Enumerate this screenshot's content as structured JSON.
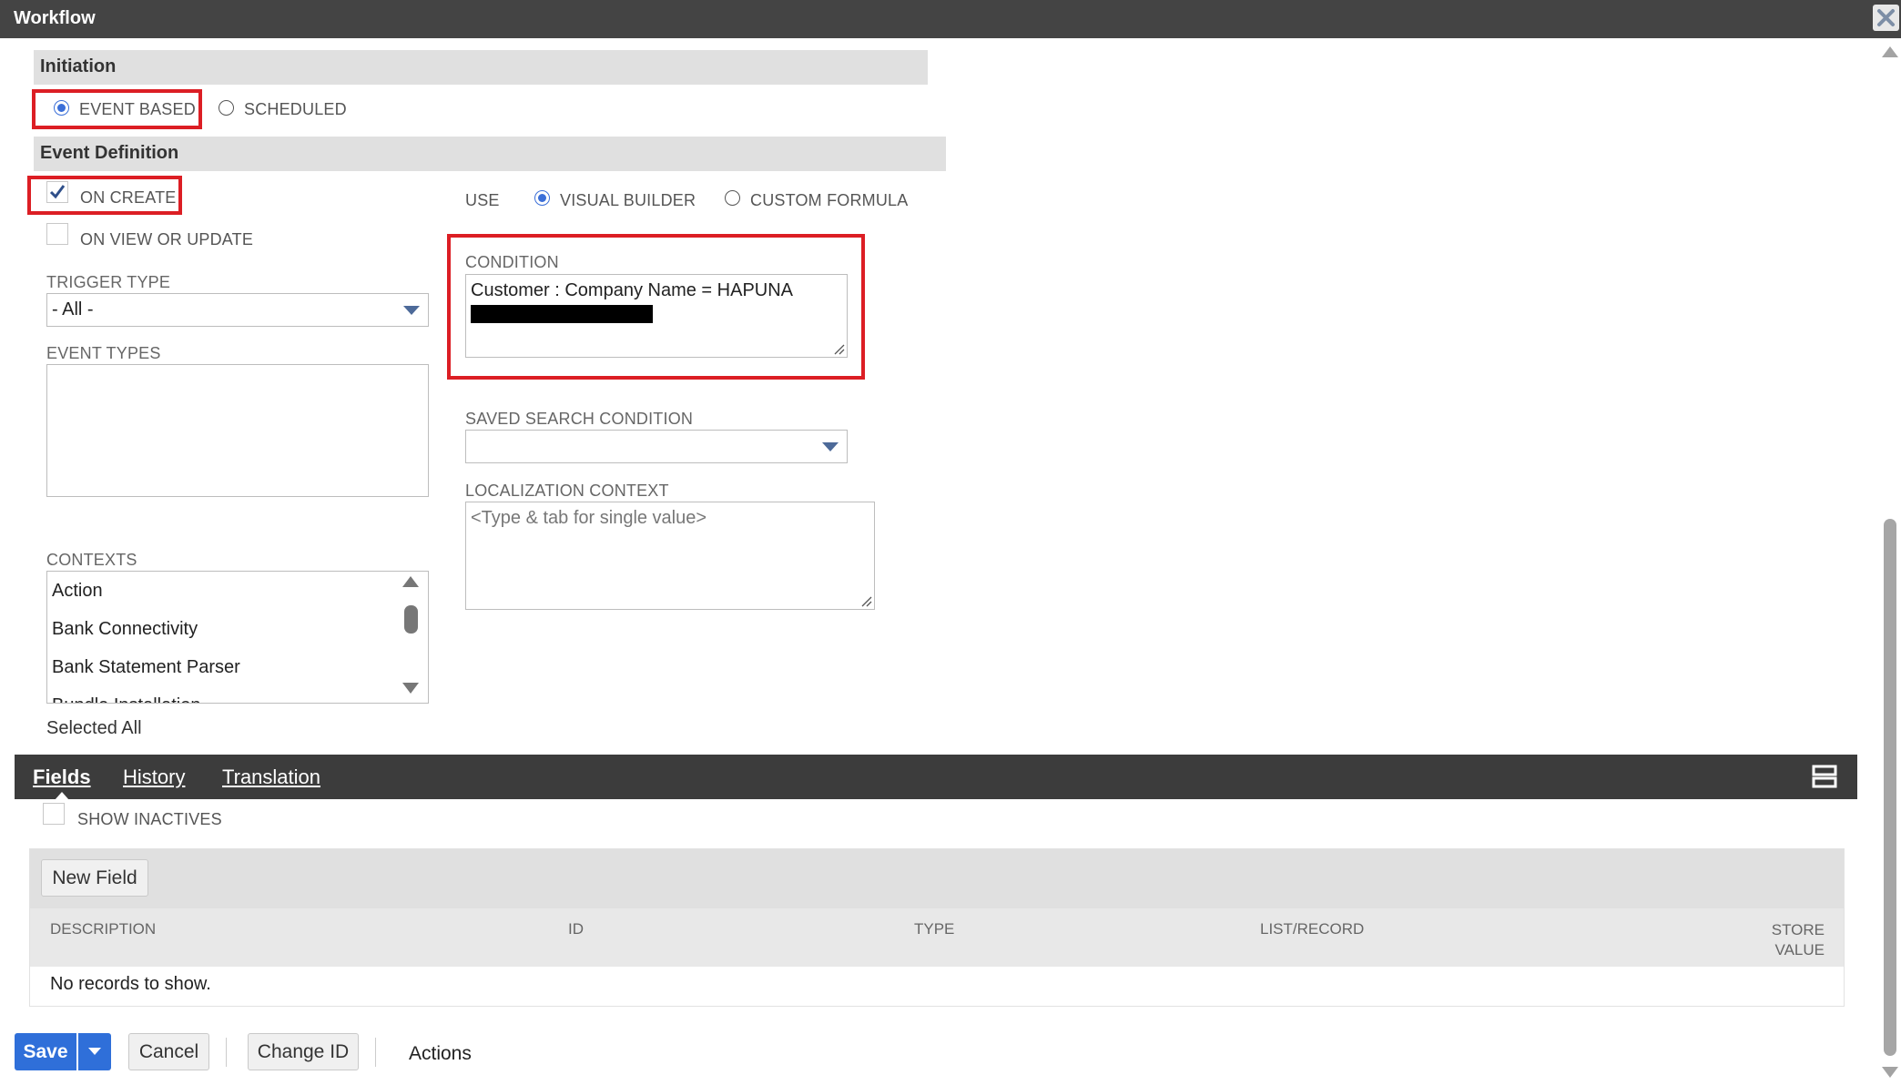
{
  "window": {
    "title": "Workflow"
  },
  "initiation": {
    "header": "Initiation",
    "options": [
      {
        "label": "EVENT BASED",
        "selected": true
      },
      {
        "label": "SCHEDULED",
        "selected": false
      }
    ]
  },
  "event_definition": {
    "header": "Event Definition",
    "on_create": {
      "label": "ON CREATE",
      "checked": true
    },
    "on_view_or_update": {
      "label": "ON VIEW OR UPDATE",
      "checked": false
    },
    "trigger_type": {
      "label": "TRIGGER TYPE",
      "value": "- All -"
    },
    "event_types": {
      "label": "EVENT TYPES"
    },
    "contexts": {
      "label": "CONTEXTS",
      "items": [
        "Action",
        "Bank Connectivity",
        "Bank Statement Parser",
        "Bundle Installation"
      ]
    },
    "selected_summary": "Selected All",
    "use": {
      "label": "USE",
      "options": [
        {
          "label": "VISUAL BUILDER",
          "selected": true
        },
        {
          "label": "CUSTOM FORMULA",
          "selected": false
        }
      ]
    },
    "condition": {
      "label": "CONDITION",
      "value": "Customer : Company Name = HAPUNA"
    },
    "saved_search_condition": {
      "label": "SAVED SEARCH CONDITION",
      "value": ""
    },
    "localization_context": {
      "label": "LOCALIZATION CONTEXT",
      "placeholder": "<Type & tab for single value>"
    }
  },
  "subtabs": {
    "tabs": [
      {
        "label": "Fields",
        "active": true
      },
      {
        "label": "History",
        "active": false
      },
      {
        "label": "Translation",
        "active": false
      }
    ]
  },
  "fields_tab": {
    "show_inactives": {
      "label": "SHOW INACTIVES",
      "checked": false
    },
    "new_field_button": "New Field",
    "columns": [
      "DESCRIPTION",
      "ID",
      "TYPE",
      "LIST/RECORD",
      "STORE VALUE"
    ],
    "empty_message": "No records to show."
  },
  "footer": {
    "save": "Save",
    "cancel": "Cancel",
    "change_id": "Change ID",
    "actions": "Actions"
  },
  "colors": {
    "titlebar": "#444444",
    "accent_blue": "#2f6fd9",
    "highlight_red": "#dc1e24",
    "section_grey": "#e0e0e0"
  }
}
